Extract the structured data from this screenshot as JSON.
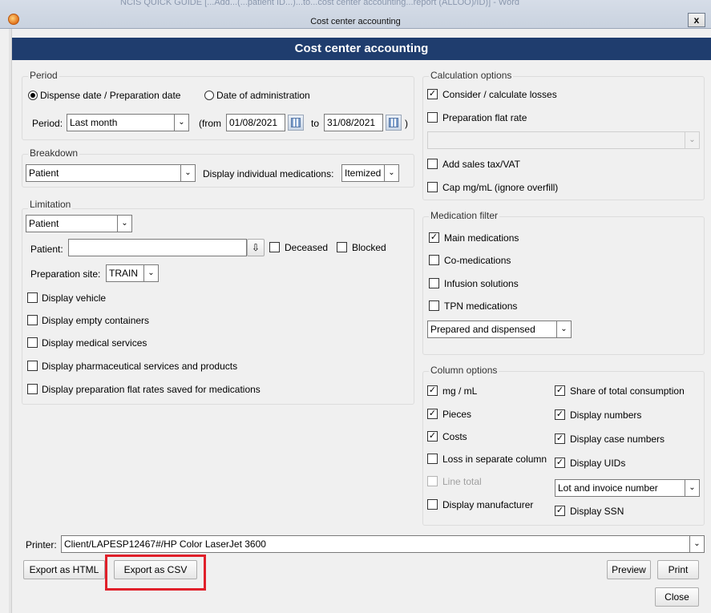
{
  "window": {
    "background_title": "NCIS QUICK GUIDE [...Add...(...patient ID...)...to...cost center accounting...report (ALLOO)/ID)] - Word",
    "title": "Cost center accounting",
    "close_symbol": "x"
  },
  "header": {
    "title": "Cost center accounting"
  },
  "period": {
    "group_label": "Period",
    "radio_dispense": "Dispense date / Preparation date",
    "radio_administration": "Date of administration",
    "selected": "Dispense date / Preparation date",
    "period_label": "Period:",
    "period_value": "Last month",
    "from_label": "(from",
    "from_value": "01/08/2021",
    "to_label": "to",
    "to_value": "31/08/2021",
    "close_paren": ")"
  },
  "breakdown": {
    "group_label": "Breakdown",
    "value": "Patient",
    "display_meds_label": "Display individual medications:",
    "display_meds_value": "Itemized"
  },
  "limitation": {
    "group_label": "Limitation",
    "type_value": "Patient",
    "patient_label": "Patient:",
    "patient_value": "",
    "deceased_label": "Deceased",
    "deceased_checked": false,
    "blocked_label": "Blocked",
    "blocked_checked": false,
    "prep_site_label": "Preparation site:",
    "prep_site_value": "TRAIN",
    "options": [
      {
        "label": "Display vehicle",
        "checked": false
      },
      {
        "label": "Display empty containers",
        "checked": false
      },
      {
        "label": "Display medical services",
        "checked": false
      },
      {
        "label": "Display pharmaceutical services and products",
        "checked": false
      },
      {
        "label": "Display preparation flat rates saved for medications",
        "checked": false
      }
    ]
  },
  "calculation": {
    "group_label": "Calculation options",
    "consider_losses": {
      "label": "Consider / calculate losses",
      "checked": true
    },
    "prep_flat_rate": {
      "label": "Preparation flat rate",
      "checked": false
    },
    "flat_rate_value": "",
    "sales_tax": {
      "label": "Add sales tax/VAT",
      "checked": false
    },
    "cap": {
      "label": "Cap mg/mL (ignore overfill)",
      "checked": false
    }
  },
  "medication_filter": {
    "group_label": "Medication filter",
    "options": [
      {
        "label": "Main medications",
        "checked": true
      },
      {
        "label": "Co-medications",
        "checked": false
      },
      {
        "label": "Infusion solutions",
        "checked": false
      },
      {
        "label": "TPN medications",
        "checked": false
      }
    ],
    "status_value": "Prepared and dispensed"
  },
  "column_options": {
    "group_label": "Column options",
    "left": [
      {
        "label": "mg / mL",
        "checked": true,
        "disabled": false
      },
      {
        "label": "Pieces",
        "checked": true,
        "disabled": false
      },
      {
        "label": "Costs",
        "checked": true,
        "disabled": false
      },
      {
        "label": "Loss in separate column",
        "checked": false,
        "disabled": false
      },
      {
        "label": "Line total",
        "checked": false,
        "disabled": true
      },
      {
        "label": "Display manufacturer",
        "checked": false,
        "disabled": false
      }
    ],
    "right": [
      {
        "label": "Share of total consumption",
        "checked": true
      },
      {
        "label": "Display numbers",
        "checked": true
      },
      {
        "label": "Display case numbers",
        "checked": true
      },
      {
        "label": "Display UIDs",
        "checked": true
      }
    ],
    "uid_mode_value": "Lot and invoice number",
    "ssn": {
      "label": "Display SSN",
      "checked": true
    }
  },
  "printer": {
    "label": "Printer:",
    "value": "Client/LAPESP12467#/HP Color LaserJet 3600"
  },
  "buttons": {
    "export_html": "Export as HTML",
    "export_csv": "Export as CSV",
    "preview": "Preview",
    "print": "Print",
    "close": "Close"
  },
  "symbols": {
    "check": "✓",
    "dropdown": "⌄",
    "lookup": "⇩"
  },
  "colors": {
    "header_bg": "#1f3d6e",
    "highlight": "#e0202a"
  }
}
